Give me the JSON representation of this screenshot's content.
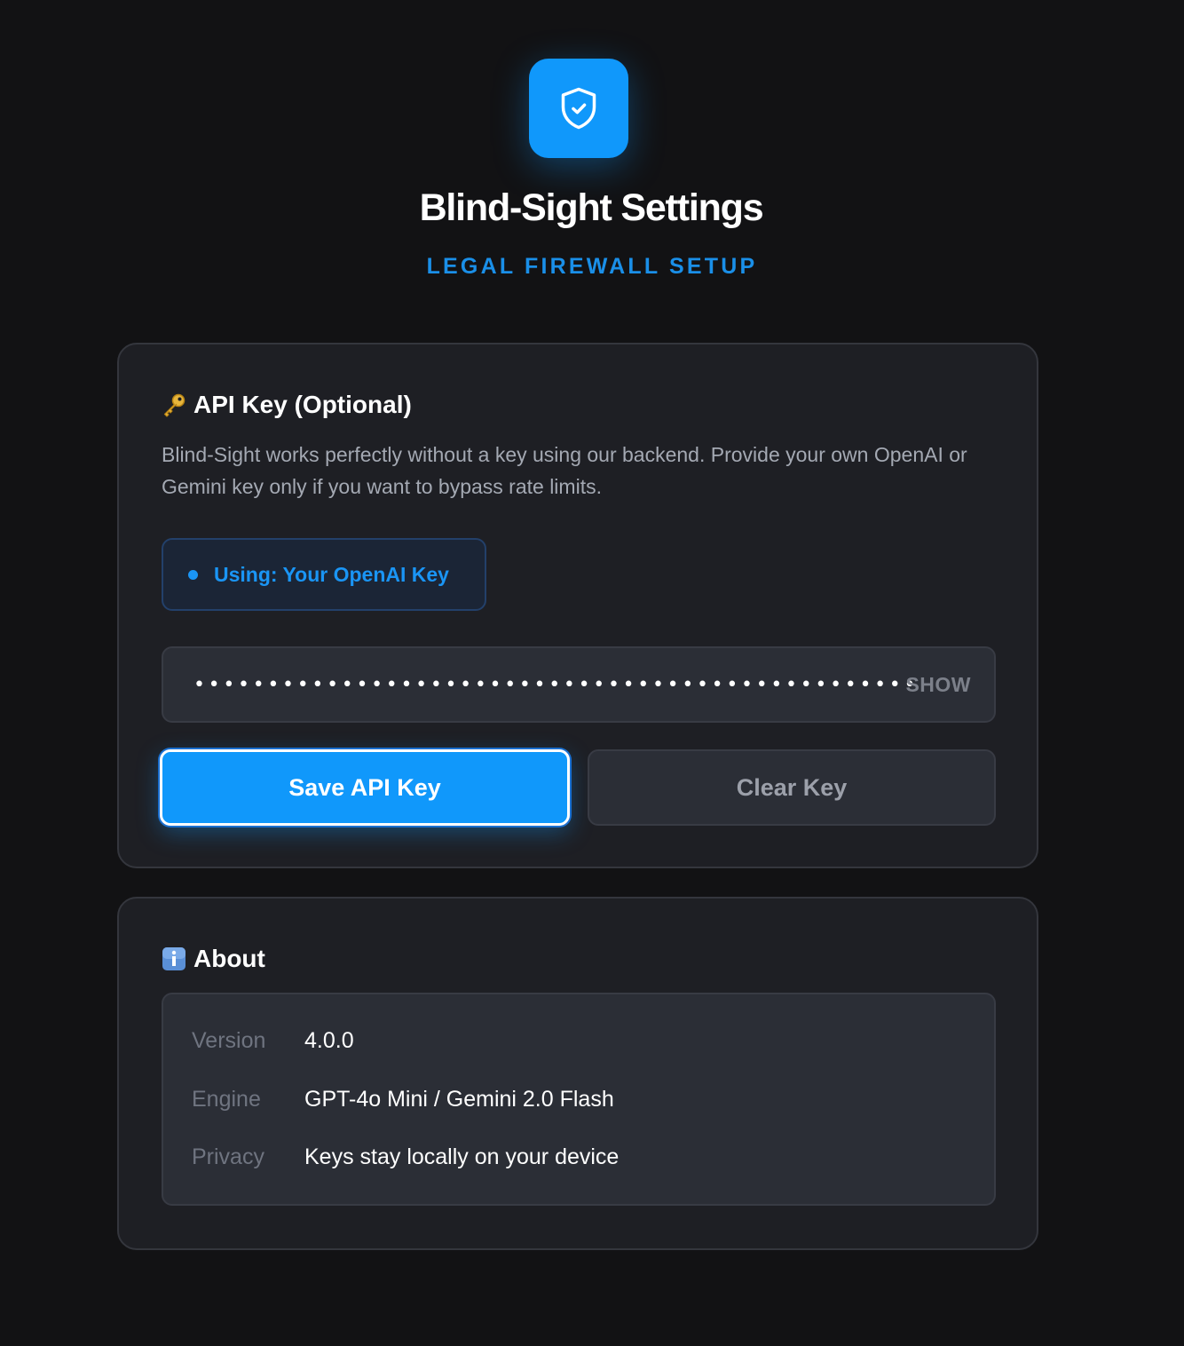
{
  "header": {
    "logo_icon": "shield-check-icon",
    "title": "Blind-Sight Settings",
    "subtitle": "LEGAL FIREWALL SETUP",
    "accent_color": "#1098fb"
  },
  "api_card": {
    "icon": "key-icon",
    "title": "API Key (Optional)",
    "description": "Blind-Sight works perfectly without a key using our backend. Provide your own OpenAI or Gemini key only if you want to bypass rate limits.",
    "status": "Using: Your OpenAI Key",
    "key_masked": "•••••••••••••••••••••••••••••••••••••••••••••••••",
    "show_label": "SHOW",
    "save_label": "Save API Key",
    "clear_label": "Clear Key"
  },
  "about_card": {
    "icon": "info-icon",
    "title": "About",
    "rows": [
      {
        "label": "Version",
        "value": "4.0.0"
      },
      {
        "label": "Engine",
        "value": "GPT-4o Mini / Gemini 2.0 Flash"
      },
      {
        "label": "Privacy",
        "value": "Keys stay locally on your device"
      }
    ]
  }
}
